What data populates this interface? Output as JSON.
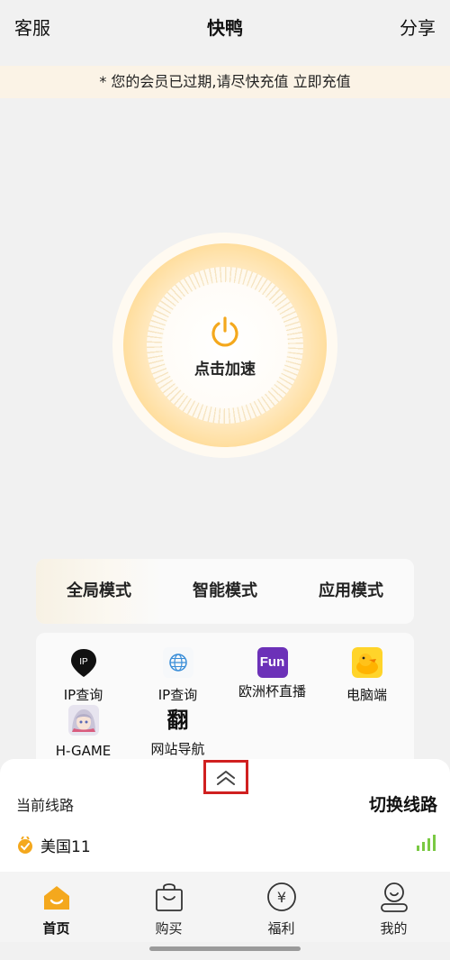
{
  "header": {
    "left": "客服",
    "title": "快鸭",
    "right": "分享"
  },
  "notice": {
    "text": "* 您的会员已过期,请尽快充值",
    "action": "立即充值"
  },
  "power": {
    "label": "点击加速",
    "icon": "power-icon"
  },
  "modes": [
    "全局模式",
    "智能模式",
    "应用模式"
  ],
  "active_mode": "全局模式",
  "shortcuts": [
    {
      "label": "IP查询",
      "icon": "ip-location-pin-icon"
    },
    {
      "label": "IP查询",
      "icon": "globe-icon"
    },
    {
      "label": "欧洲杯直播",
      "icon": "fun-app-icon",
      "icon_text": "Fun"
    },
    {
      "label": "电脑端",
      "icon": "duck-icon"
    },
    {
      "label": "H-GAME",
      "icon": "anime-avatar-icon"
    },
    {
      "label": "网站导航",
      "icon": "fan-character-icon",
      "icon_text": "翻"
    }
  ],
  "line": {
    "label": "当前线路",
    "switch": "切换线路",
    "server": "美国11",
    "signal_color": "#7ac943"
  },
  "nav": [
    {
      "label": "首页",
      "icon": "home-icon",
      "active": true
    },
    {
      "label": "购买",
      "icon": "shopping-bag-icon",
      "active": false
    },
    {
      "label": "福利",
      "icon": "yen-coin-icon",
      "active": false
    },
    {
      "label": "我的",
      "icon": "profile-icon",
      "active": false
    }
  ],
  "colors": {
    "accent": "#f4a81d",
    "highlight_border": "#d02020"
  }
}
